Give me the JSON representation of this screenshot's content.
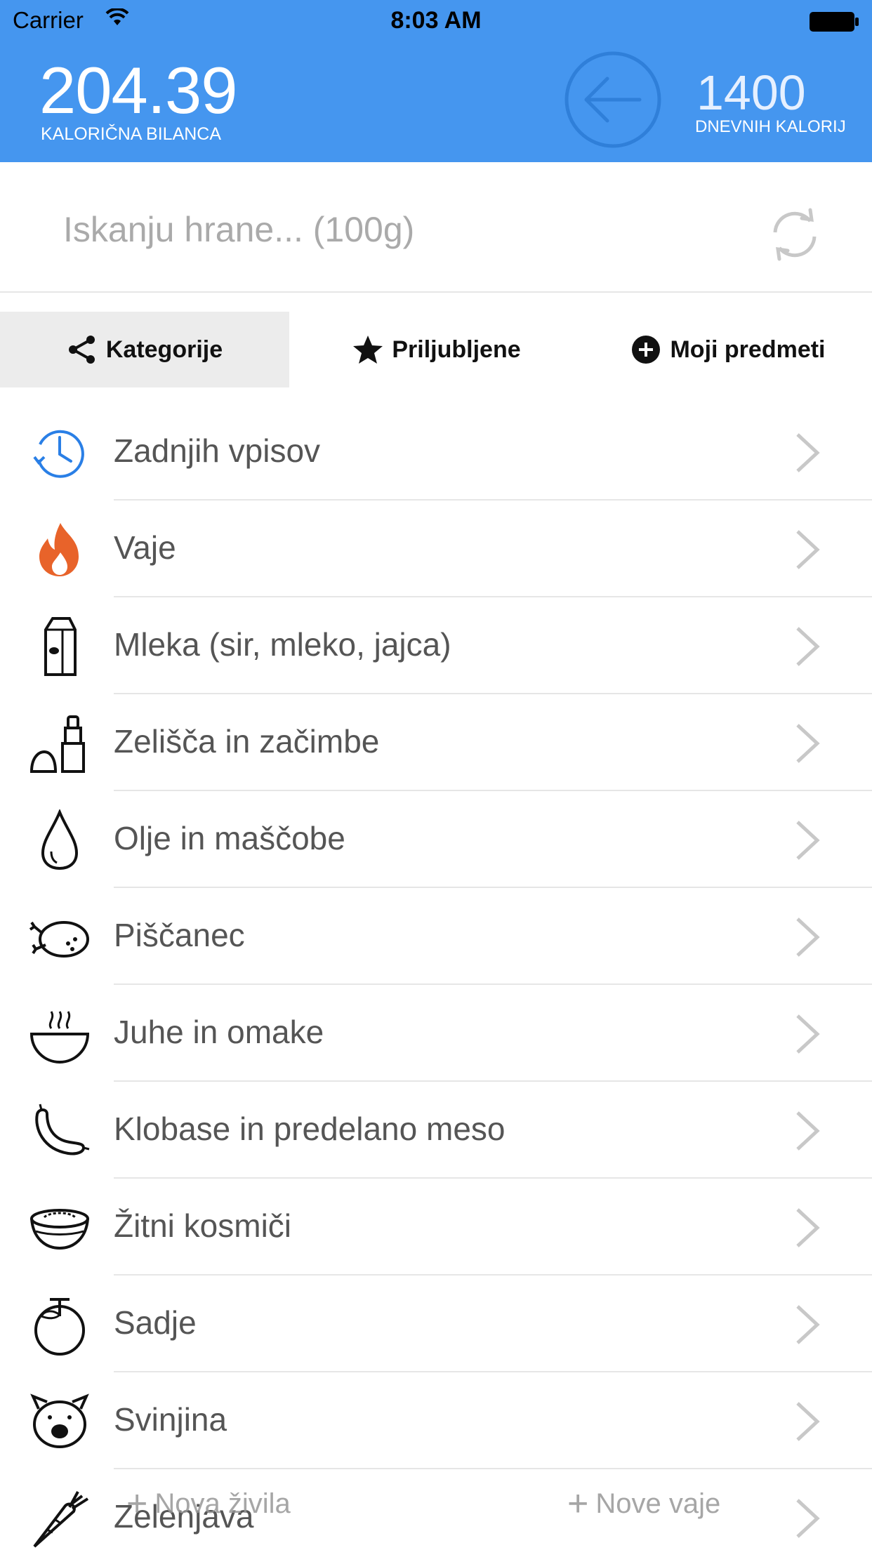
{
  "status_bar": {
    "carrier": "Carrier",
    "time": "8:03 AM"
  },
  "header": {
    "balance_value": "204.39",
    "balance_label": "KALORIČNA BILANCA",
    "daily_value": "1400",
    "daily_label": "DNEVNIH KALORIJ"
  },
  "search": {
    "placeholder": "Iskanju hrane... (100g)"
  },
  "tabs": [
    {
      "label": "Kategorije"
    },
    {
      "label": "Priljubljene"
    },
    {
      "label": "Moji predmeti"
    }
  ],
  "categories": [
    {
      "label": "Zadnjih vpisov",
      "icon": "clock-icon"
    },
    {
      "label": "Vaje",
      "icon": "flame-icon"
    },
    {
      "label": "Mleka (sir, mleko, jajca)",
      "icon": "milk-carton-icon"
    },
    {
      "label": "Zelišča in začimbe",
      "icon": "spice-icon"
    },
    {
      "label": "Olje in maščobe",
      "icon": "oil-drop-icon"
    },
    {
      "label": "Piščanec",
      "icon": "chicken-icon"
    },
    {
      "label": "Juhe in omake",
      "icon": "soup-bowl-icon"
    },
    {
      "label": "Klobase in predelano meso",
      "icon": "sausage-icon"
    },
    {
      "label": "Žitni kosmiči",
      "icon": "cereal-bowl-icon"
    },
    {
      "label": "Sadje",
      "icon": "fruit-icon"
    },
    {
      "label": "Svinjina",
      "icon": "pig-icon"
    },
    {
      "label": "Zelenjava",
      "icon": "carrot-icon"
    }
  ],
  "bottom_actions": {
    "new_food": "Nova živila",
    "new_exercise": "Nove vaje"
  },
  "colors": {
    "header_bg": "#4596ef",
    "tab_active_bg": "#ececec",
    "accent_blue": "#2a7fe6",
    "flame": "#e8632a"
  }
}
